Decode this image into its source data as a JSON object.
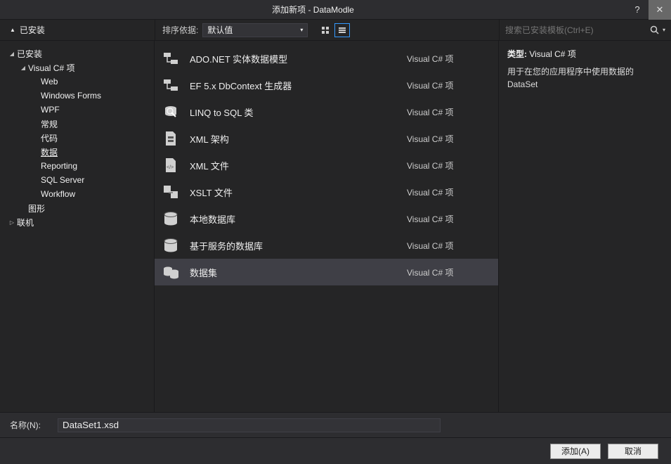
{
  "window": {
    "title": "添加新项 - DataModle",
    "help": "?",
    "close": "✕"
  },
  "toolbar": {
    "tree_header": "已安装",
    "sort_label": "排序依据:",
    "sort_value": "默认值",
    "search_placeholder": "搜索已安装模板(Ctrl+E)"
  },
  "tree": [
    {
      "label": "已安装",
      "level": 0,
      "expanded": true,
      "children": true
    },
    {
      "label": "Visual C# 项",
      "level": 1,
      "expanded": true,
      "children": true
    },
    {
      "label": "Web",
      "level": 2
    },
    {
      "label": "Windows Forms",
      "level": 2
    },
    {
      "label": "WPF",
      "level": 2
    },
    {
      "label": "常规",
      "level": 2
    },
    {
      "label": "代码",
      "level": 2
    },
    {
      "label": "数据",
      "level": 2,
      "selected": true
    },
    {
      "label": "Reporting",
      "level": 2
    },
    {
      "label": "SQL Server",
      "level": 2
    },
    {
      "label": "Workflow",
      "level": 2
    },
    {
      "label": "图形",
      "level": 1
    },
    {
      "label": "联机",
      "level": 0,
      "expanded": false,
      "children": true
    }
  ],
  "templates": [
    {
      "name": "ADO.NET 实体数据模型",
      "lang": "Visual C# 项",
      "icon": "entity"
    },
    {
      "name": "EF 5.x DbContext 生成器",
      "lang": "Visual C# 项",
      "icon": "entity"
    },
    {
      "name": "LINQ to SQL 类",
      "lang": "Visual C# 项",
      "icon": "linq"
    },
    {
      "name": "XML 架构",
      "lang": "Visual C# 项",
      "icon": "xsd"
    },
    {
      "name": "XML 文件",
      "lang": "Visual C# 项",
      "icon": "xml"
    },
    {
      "name": "XSLT 文件",
      "lang": "Visual C# 项",
      "icon": "xslt"
    },
    {
      "name": "本地数据库",
      "lang": "Visual C# 项",
      "icon": "db"
    },
    {
      "name": "基于服务的数据库",
      "lang": "Visual C# 项",
      "icon": "db"
    },
    {
      "name": "数据集",
      "lang": "Visual C# 项",
      "icon": "dataset",
      "selected": true
    }
  ],
  "details": {
    "type_label": "类型:",
    "type_value": "Visual C# 项",
    "description": "用于在您的应用程序中使用数据的 DataSet"
  },
  "footer": {
    "name_label": "名称(N):",
    "name_value": "DataSet1.xsd",
    "add": "添加(A)",
    "cancel": "取消"
  }
}
